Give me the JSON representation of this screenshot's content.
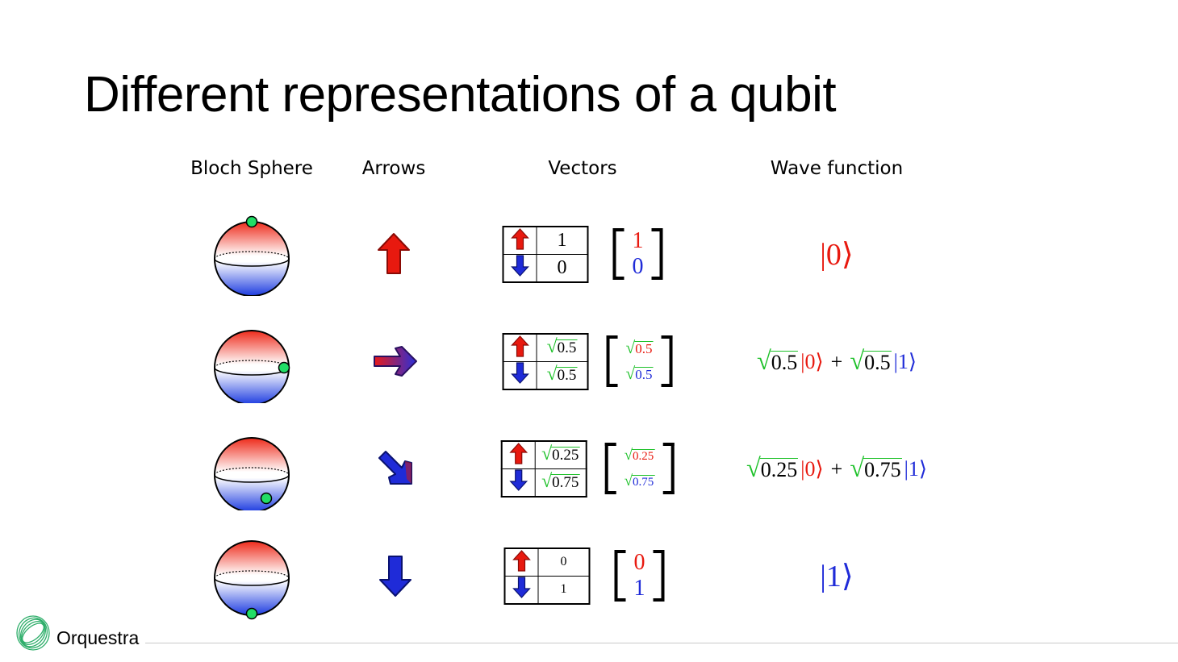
{
  "slide": {
    "title": "Different representations of a qubit",
    "columns": [
      "Bloch Sphere",
      "Arrows",
      "Vectors",
      "Wave function"
    ]
  },
  "rows": [
    {
      "state": "zero",
      "table_values": [
        "1",
        "0"
      ],
      "vector_top": "1",
      "vector_bottom": "0",
      "wave": "|0⟩"
    },
    {
      "state": "equal",
      "table_values": [
        "0.5",
        "0.5"
      ],
      "vector_top": "0.5",
      "vector_bottom": "0.5",
      "wave_coef_a": "0.5",
      "wave_ket_a": "|0⟩",
      "wave_plus": "+",
      "wave_coef_b": "0.5",
      "wave_ket_b": "|1⟩"
    },
    {
      "state": "quarter",
      "table_values": [
        "0.25",
        "0.75"
      ],
      "vector_top": "0.25",
      "vector_bottom": "0.75",
      "wave_coef_a": "0.25",
      "wave_ket_a": "|0⟩",
      "wave_plus": "+",
      "wave_coef_b": "0.75",
      "wave_ket_b": "|1⟩"
    },
    {
      "state": "one",
      "table_values": [
        "0",
        "1"
      ],
      "vector_top": "0",
      "vector_bottom": "1",
      "wave": "|1⟩"
    }
  ],
  "branding": {
    "logo_text": "Orquestra"
  },
  "colors": {
    "up": "#e8190f",
    "down": "#1f2bd8",
    "sqrt": "#1ec12a",
    "point": "#22dd66"
  },
  "icons": [
    "bloch-sphere-icon",
    "arrow-up-icon",
    "arrow-right-icon",
    "arrow-down-right-icon",
    "arrow-down-icon",
    "orquestra-logo-icon"
  ]
}
